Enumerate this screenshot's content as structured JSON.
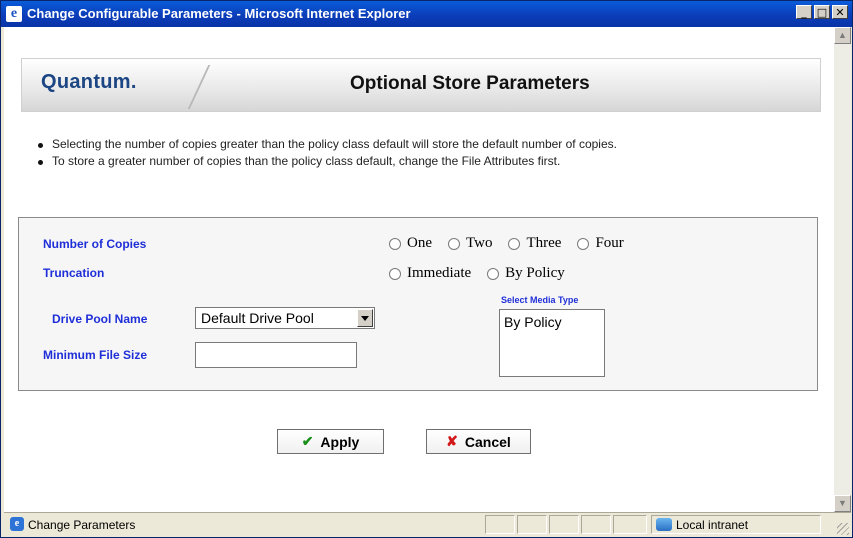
{
  "window": {
    "title": "Change Configurable Parameters - Microsoft Internet Explorer",
    "controls": {
      "minimize": "_",
      "maximize": "□",
      "close": "✕"
    }
  },
  "header": {
    "logo_text": "Quantum.",
    "page_title": "Optional Store Parameters"
  },
  "notes": [
    "Selecting the number of copies greater than the policy class default will store the default number of copies.",
    "To store a greater number of copies than the policy class default, change the File Attributes first."
  ],
  "form": {
    "copies_label": "Number of Copies",
    "copies_options": [
      "One",
      "Two",
      "Three",
      "Four"
    ],
    "truncation_label": "Truncation",
    "truncation_options": [
      "Immediate",
      "By Policy"
    ],
    "drive_pool_label": "Drive Pool Name",
    "drive_pool_value": "Default Drive Pool",
    "min_file_size_label": "Minimum File Size",
    "min_file_size_value": "",
    "media_type_label": "Select Media Type",
    "media_type_options": [
      "By Policy"
    ]
  },
  "buttons": {
    "apply_label": "Apply",
    "cancel_label": "Cancel"
  },
  "statusbar": {
    "text": "Change Parameters",
    "zone": "Local intranet"
  },
  "colors": {
    "label_blue": "#1f2fd8",
    "logo_blue": "#1b4583",
    "titlebar_blue": "#0A5CD9"
  }
}
